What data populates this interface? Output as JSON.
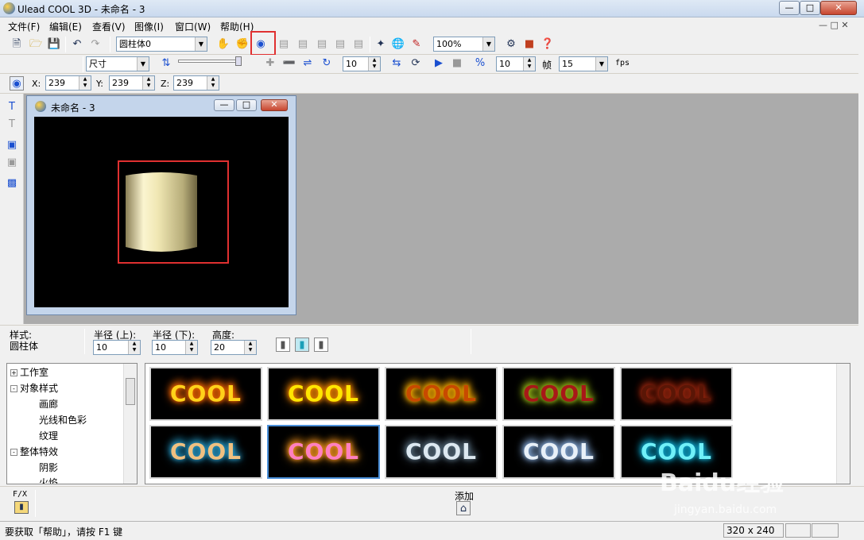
{
  "window": {
    "title": "Ulead COOL 3D - 未命名 - 3"
  },
  "menu": [
    "文件(F)",
    "编辑(E)",
    "查看(V)",
    "图像(I)",
    "窗口(W)",
    "帮助(H)"
  ],
  "toolbar1": {
    "object_select": "圆柱体0",
    "zoom": "100%"
  },
  "toolbar2": {
    "attr_select": "尺寸",
    "frame_value": "10",
    "frame_count": "10",
    "frame_label": "帧",
    "fps_value": "15",
    "fps_label": "fps"
  },
  "coords": {
    "x_label": "X:",
    "x": "239",
    "y_label": "Y:",
    "y": "239",
    "z_label": "Z:",
    "z": "239"
  },
  "doc": {
    "title": "未命名 - 3"
  },
  "props": {
    "style_label": "样式:",
    "style_value": "圆柱体",
    "r_top_label": "半径 (上):",
    "r_top": "10",
    "r_bottom_label": "半径 (下):",
    "r_bottom": "10",
    "height_label": "高度:",
    "height": "20"
  },
  "tree": [
    {
      "label": "工作室",
      "level": 0,
      "box": "+"
    },
    {
      "label": "对象样式",
      "level": 0,
      "box": "-"
    },
    {
      "label": "画廊",
      "level": 1
    },
    {
      "label": "光线和色彩",
      "level": 1
    },
    {
      "label": "纹理",
      "level": 1
    },
    {
      "label": "整体特效",
      "level": 0,
      "box": "-"
    },
    {
      "label": "阴影",
      "level": 1
    },
    {
      "label": "火焰",
      "level": 1
    }
  ],
  "gallery": {
    "thumb_text": "COOL",
    "items": [
      {
        "color": "#ffd21a",
        "glow": "#ff6a00"
      },
      {
        "color": "#ffe600",
        "glow": "#ff8c00"
      },
      {
        "color": "#c84a00",
        "glow": "#ffb000"
      },
      {
        "color": "#a81818",
        "glow": "#9ec01a"
      },
      {
        "color": "#5a1606",
        "glow": "#a02810"
      },
      {
        "color": "#f0c080",
        "glow": "#2aa0d0"
      },
      {
        "color": "#ff80c0",
        "glow": "#ff9a20"
      },
      {
        "color": "#dce8f0",
        "glow": "#5a7080"
      },
      {
        "color": "#e8f0f8",
        "glow": "#8ab0e0"
      },
      {
        "color": "#70f0f8",
        "glow": "#10b0d8"
      }
    ]
  },
  "bottom": {
    "fx_label": "F/X",
    "add_label": "添加"
  },
  "status": {
    "help_text": "要获取「帮助」，请按 F1 键",
    "size": "320 x 240"
  },
  "watermark": {
    "brand": "Baidu经验",
    "url": "jingyan.baidu.com"
  }
}
